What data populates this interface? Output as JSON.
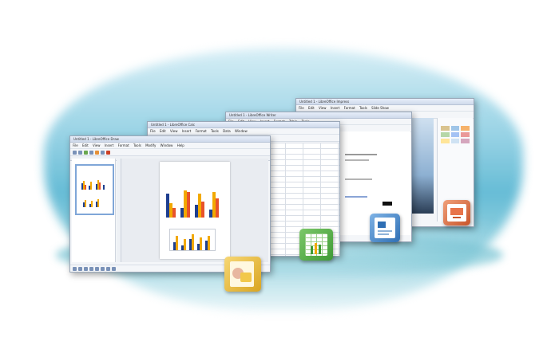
{
  "windows": {
    "impress": {
      "title": "Untitled 1 - LibreOffice Impress",
      "menus": [
        "File",
        "Edit",
        "View",
        "Insert",
        "Format",
        "Tools",
        "Slide Show",
        "Window",
        "Help"
      ]
    },
    "draw": {
      "title": "Untitled 1 - LibreOffice Draw",
      "menus": [
        "File",
        "Edit",
        "View",
        "Insert",
        "Format",
        "Tools",
        "Modify",
        "Window",
        "Help"
      ]
    },
    "calc": {
      "title": "Untitled 1 - LibreOffice Calc",
      "menus": [
        "File",
        "Edit",
        "View",
        "Insert",
        "Format",
        "Tools",
        "Data",
        "Window",
        "Help"
      ]
    },
    "writer": {
      "title": "Untitled 1 - LibreOffice Writer",
      "menus": [
        "File",
        "Edit",
        "View",
        "Insert",
        "Format",
        "Table",
        "Tools",
        "Window",
        "Help"
      ]
    }
  },
  "icons": [
    "draw-app-icon",
    "calc-app-icon",
    "writer-app-icon",
    "impress-app-icon"
  ],
  "colors": {
    "series_navy": "#1f3f8f",
    "series_gold": "#f2a900",
    "series_red": "#e8532b"
  }
}
